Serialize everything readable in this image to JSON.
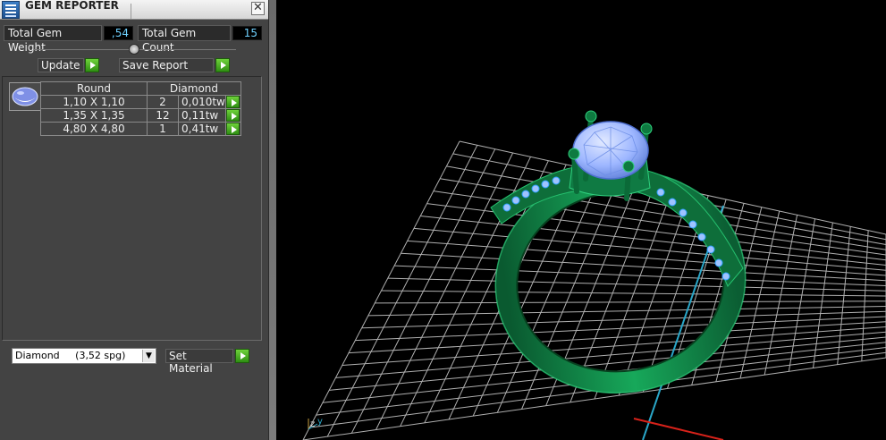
{
  "window": {
    "title": "GEM REPORTER",
    "close_glyph": "✕"
  },
  "stats": {
    "weight_label": "Total Gem Weight",
    "weight_value": ",54",
    "count_label": "Total Gem Count",
    "count_value": "15"
  },
  "actions": {
    "update_label": "Update",
    "save_label": "Save Report"
  },
  "table": {
    "shape_header": "Round",
    "type_header": "Diamond",
    "rows": [
      {
        "size": "1,10 X 1,10",
        "qty": "2",
        "weight": "0,010tw"
      },
      {
        "size": "1,35 X 1,35",
        "qty": "12",
        "weight": "0,11tw"
      },
      {
        "size": "4,80 X 4,80",
        "qty": "1",
        "weight": "0,41tw"
      }
    ]
  },
  "material": {
    "selected": "Diamond     (3,52 spg)",
    "set_label": "Set Material"
  },
  "viewport": {
    "axis_z": "z",
    "axis_y": "y"
  },
  "colors": {
    "value_text": "#6fd1ff",
    "metal": "#0f7a43",
    "gem": "#9fb8ff",
    "grid": "#d8d8d8"
  },
  "icons": [
    "app-icon",
    "close-icon",
    "slider-knob-icon",
    "go-arrow-icon",
    "gem-shape-icon",
    "dropdown-arrow-icon",
    "axis-gizmo-icon"
  ]
}
